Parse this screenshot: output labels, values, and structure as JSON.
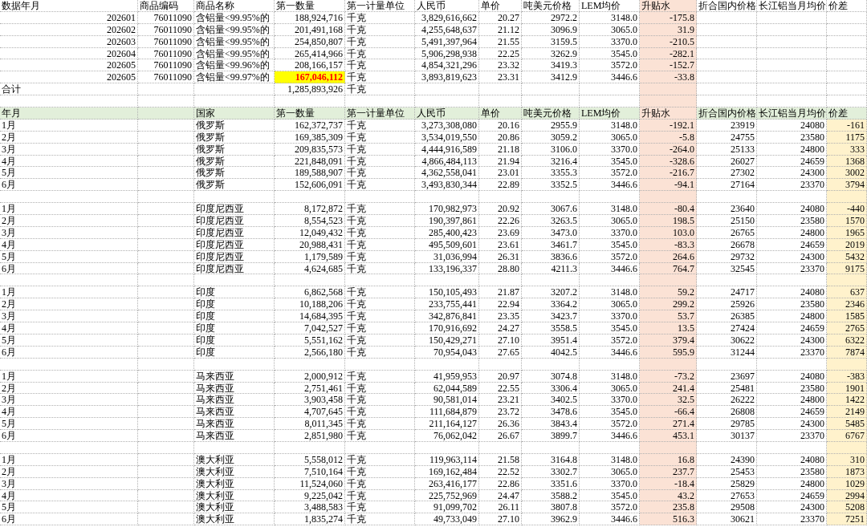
{
  "top_table": {
    "columns": [
      "数据年月",
      "商品编码",
      "商品名称",
      "第一数量",
      "第一计量单位",
      "人民币",
      "单价",
      "吨美元价格",
      "LEM均价",
      "升贴水",
      "折合国内价格",
      "长江铝当月均价",
      "价差"
    ],
    "rows": [
      {
        "cells": [
          "202601",
          "76011090",
          "含铝量<99.95%的",
          "188,924,716",
          "千克",
          "3,829,616,662",
          "20.27",
          "2972.2",
          "3148.0",
          "-175.8"
        ],
        "highlighted": false
      },
      {
        "cells": [
          "202602",
          "76011090",
          "含铝量<99.95%的",
          "201,491,168",
          "千克",
          "4,255,648,637",
          "21.12",
          "3096.9",
          "3065.0",
          "31.9"
        ],
        "highlighted": false
      },
      {
        "cells": [
          "202603",
          "76011090",
          "含铝量<99.95%的",
          "254,850,807",
          "千克",
          "5,491,397,964",
          "21.55",
          "3159.5",
          "3370.0",
          "-210.5"
        ],
        "highlighted": false
      },
      {
        "cells": [
          "202604",
          "76011090",
          "含铝量<99.95%的",
          "265,414,966",
          "千克",
          "5,906,298,938",
          "22.25",
          "3262.9",
          "3545.0",
          "-282.1"
        ],
        "highlighted": false
      },
      {
        "cells": [
          "202605",
          "76011090",
          "含铝量<99.96%的",
          "208,166,157",
          "千克",
          "4,854,321,296",
          "23.32",
          "3419.3",
          "3572.0",
          "-152.7"
        ],
        "highlighted": false
      },
      {
        "cells": [
          "202605",
          "76011090",
          "含铝量<99.97%的",
          "167,046,112",
          "千克",
          "3,893,819,623",
          "23.31",
          "3412.9",
          "3446.6",
          "-33.8"
        ],
        "highlighted": true
      }
    ],
    "total": {
      "label": "合计",
      "quantity": "1,285,893,926",
      "unit": "千克"
    }
  },
  "country_table": {
    "columns": [
      "年月",
      "国家",
      "第一数量",
      "第一计量单位",
      "人民币",
      "单价",
      "吨美元价格",
      "LEM均价",
      "升贴水",
      "折合国内价格",
      "长江铝当月均价",
      "价差"
    ],
    "groups": [
      {
        "rows": [
          [
            "1月",
            "俄罗斯",
            "162,372,737",
            "千克",
            "3,273,308,080",
            "20.16",
            "2955.9",
            "3148.0",
            "-192.1",
            "23919",
            "24080",
            "-161"
          ],
          [
            "2月",
            "俄罗斯",
            "169,385,309",
            "千克",
            "3,534,019,550",
            "20.86",
            "3059.2",
            "3065.0",
            "-5.8",
            "24755",
            "23580",
            "1175"
          ],
          [
            "3月",
            "俄罗斯",
            "209,835,573",
            "千克",
            "4,444,916,589",
            "21.18",
            "3106.0",
            "3370.0",
            "-264.0",
            "25133",
            "24800",
            "333"
          ],
          [
            "4月",
            "俄罗斯",
            "221,848,091",
            "千克",
            "4,866,484,113",
            "21.94",
            "3216.4",
            "3545.0",
            "-328.6",
            "26027",
            "24659",
            "1368"
          ],
          [
            "5月",
            "俄罗斯",
            "189,588,907",
            "千克",
            "4,362,558,041",
            "23.01",
            "3355.3",
            "3572.0",
            "-216.7",
            "27302",
            "24300",
            "3002"
          ],
          [
            "6月",
            "俄罗斯",
            "152,606,091",
            "千克",
            "3,493,830,344",
            "22.89",
            "3352.5",
            "3446.6",
            "-94.1",
            "27164",
            "23370",
            "3794"
          ]
        ]
      },
      {
        "rows": [
          [
            "1月",
            "印度尼西亚",
            "8,172,872",
            "千克",
            "170,982,973",
            "20.92",
            "3067.6",
            "3148.0",
            "-80.4",
            "23640",
            "24080",
            "-440"
          ],
          [
            "2月",
            "印度尼西亚",
            "8,554,523",
            "千克",
            "190,397,861",
            "22.26",
            "3263.5",
            "3065.0",
            "198.5",
            "25150",
            "23580",
            "1570"
          ],
          [
            "3月",
            "印度尼西亚",
            "12,049,432",
            "千克",
            "285,400,423",
            "23.69",
            "3473.0",
            "3370.0",
            "103.0",
            "26765",
            "24800",
            "1965"
          ],
          [
            "4月",
            "印度尼西亚",
            "20,988,431",
            "千克",
            "495,509,601",
            "23.61",
            "3461.7",
            "3545.0",
            "-83.3",
            "26678",
            "24659",
            "2019"
          ],
          [
            "5月",
            "印度尼西亚",
            "1,179,589",
            "千克",
            "31,036,994",
            "26.31",
            "3836.6",
            "3572.0",
            "264.6",
            "29732",
            "24300",
            "5432"
          ],
          [
            "6月",
            "印度尼西亚",
            "4,624,685",
            "千克",
            "133,196,337",
            "28.80",
            "4211.3",
            "3446.6",
            "764.7",
            "32545",
            "23370",
            "9175"
          ]
        ]
      },
      {
        "rows": [
          [
            "1月",
            "印度",
            "6,862,568",
            "千克",
            "150,105,493",
            "21.87",
            "3207.2",
            "3148.0",
            "59.2",
            "24717",
            "24080",
            "637"
          ],
          [
            "2月",
            "印度",
            "10,188,206",
            "千克",
            "233,755,441",
            "22.94",
            "3364.2",
            "3065.0",
            "299.2",
            "25926",
            "23580",
            "2346"
          ],
          [
            "3月",
            "印度",
            "14,684,395",
            "千克",
            "342,876,841",
            "23.35",
            "3423.7",
            "3370.0",
            "53.7",
            "26385",
            "24800",
            "1585"
          ],
          [
            "4月",
            "印度",
            "7,042,527",
            "千克",
            "170,916,692",
            "24.27",
            "3558.5",
            "3545.0",
            "13.5",
            "27424",
            "24659",
            "2765"
          ],
          [
            "5月",
            "印度",
            "5,551,162",
            "千克",
            "150,429,271",
            "27.10",
            "3951.4",
            "3572.0",
            "379.4",
            "30622",
            "24300",
            "6322"
          ],
          [
            "6月",
            "印度",
            "2,566,180",
            "千克",
            "70,954,043",
            "27.65",
            "4042.5",
            "3446.6",
            "595.9",
            "31244",
            "23370",
            "7874"
          ]
        ]
      },
      {
        "rows": [
          [
            "1月",
            "马来西亚",
            "2,000,912",
            "千克",
            "41,959,953",
            "20.97",
            "3074.8",
            "3148.0",
            "-73.2",
            "23697",
            "24080",
            "-383"
          ],
          [
            "2月",
            "马来西亚",
            "2,751,461",
            "千克",
            "62,044,589",
            "22.55",
            "3306.4",
            "3065.0",
            "241.4",
            "25481",
            "23580",
            "1901"
          ],
          [
            "3月",
            "马来西亚",
            "3,903,458",
            "千克",
            "90,581,014",
            "23.21",
            "3402.5",
            "3370.0",
            "32.5",
            "26222",
            "24800",
            "1422"
          ],
          [
            "4月",
            "马来西亚",
            "4,707,645",
            "千克",
            "111,684,879",
            "23.72",
            "3478.6",
            "3545.0",
            "-66.4",
            "26808",
            "24659",
            "2149"
          ],
          [
            "5月",
            "马来西亚",
            "8,011,345",
            "千克",
            "211,164,127",
            "26.36",
            "3843.4",
            "3572.0",
            "271.4",
            "29785",
            "24300",
            "5485"
          ],
          [
            "6月",
            "马来西亚",
            "2,851,980",
            "千克",
            "76,062,042",
            "26.67",
            "3899.7",
            "3446.6",
            "453.1",
            "30137",
            "23370",
            "6767"
          ]
        ]
      },
      {
        "rows": [
          [
            "1月",
            "澳大利亚",
            "5,558,012",
            "千克",
            "119,963,114",
            "21.58",
            "3164.8",
            "3148.0",
            "16.8",
            "24390",
            "24080",
            "310"
          ],
          [
            "2月",
            "澳大利亚",
            "7,510,164",
            "千克",
            "169,162,484",
            "22.52",
            "3302.7",
            "3065.0",
            "237.7",
            "25453",
            "23580",
            "1873"
          ],
          [
            "3月",
            "澳大利亚",
            "11,524,060",
            "千克",
            "263,416,177",
            "22.86",
            "3351.6",
            "3370.0",
            "-18.4",
            "25829",
            "24800",
            "1029"
          ],
          [
            "4月",
            "澳大利亚",
            "9,225,042",
            "千克",
            "225,752,969",
            "24.47",
            "3588.2",
            "3545.0",
            "43.2",
            "27653",
            "24659",
            "2994"
          ],
          [
            "5月",
            "澳大利亚",
            "3,488,583",
            "千克",
            "91,099,702",
            "26.11",
            "3807.8",
            "3572.0",
            "235.8",
            "29508",
            "24300",
            "5208"
          ],
          [
            "6月",
            "澳大利亚",
            "1,835,274",
            "千克",
            "49,733,049",
            "27.10",
            "3962.9",
            "3446.6",
            "516.3",
            "30621",
            "23370",
            "7251"
          ]
        ]
      }
    ]
  }
}
